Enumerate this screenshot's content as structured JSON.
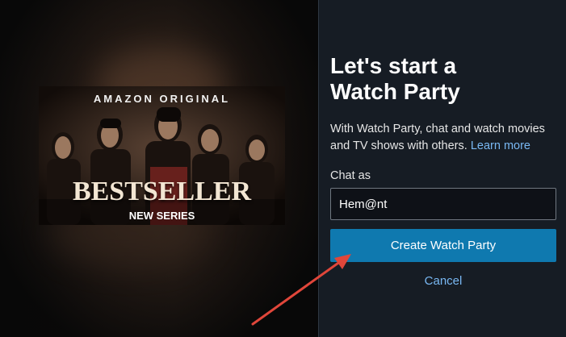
{
  "poster": {
    "brand": "AMAZON ORIGINAL",
    "title": "BESTSELLER",
    "subtitle": "NEW SERIES"
  },
  "panel": {
    "heading_line1": "Let's start a",
    "heading_line2": "Watch Party",
    "description": "With Watch Party, chat and watch movies and TV shows with others.",
    "learn_more": "Learn more",
    "chat_label": "Chat as",
    "chat_value": "Hem@nt",
    "create_button": "Create Watch Party",
    "cancel": "Cancel"
  },
  "colors": {
    "panel_bg": "#161c24",
    "button_bg": "#0f79af",
    "link": "#79b8f3",
    "annotation_arrow": "#e0463a"
  }
}
